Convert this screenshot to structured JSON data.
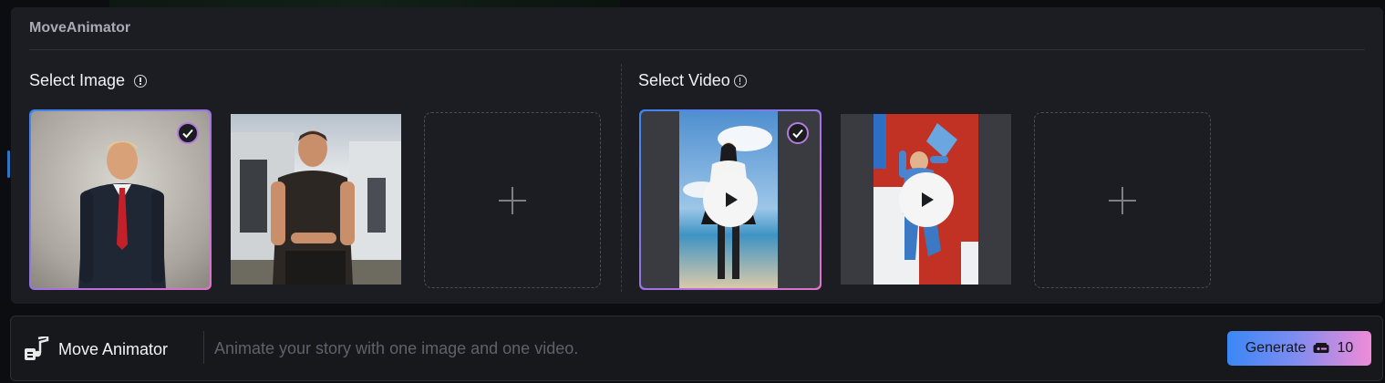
{
  "panel": {
    "title": "MoveAnimator"
  },
  "image_section": {
    "title": "Select Image",
    "info_icon": "info-icon",
    "images": [
      {
        "label": "man in navy suit with red tie",
        "selected": true
      },
      {
        "label": "man in black t-shirt in front of house",
        "selected": false
      }
    ],
    "add_icon": "plus-icon"
  },
  "video_section": {
    "title": "Select Video",
    "info_icon": "info-icon",
    "videos": [
      {
        "label": "girl dancing at beach",
        "selected": true
      },
      {
        "label": "person dancing on red background",
        "selected": false
      }
    ],
    "add_icon": "plus-icon"
  },
  "bottom_bar": {
    "brand_label": "Move Animator",
    "brand_icon": "music-note-icon",
    "prompt_placeholder": "Animate your story with one image and one video.",
    "prompt_value": "",
    "generate_label": "Generate",
    "credit_icon": "coin-icon",
    "credit_cost": "10"
  },
  "colors": {
    "panel_bg": "#1c1d22",
    "accent_blue": "#3b87f6",
    "accent_pink": "#f08bd8"
  }
}
